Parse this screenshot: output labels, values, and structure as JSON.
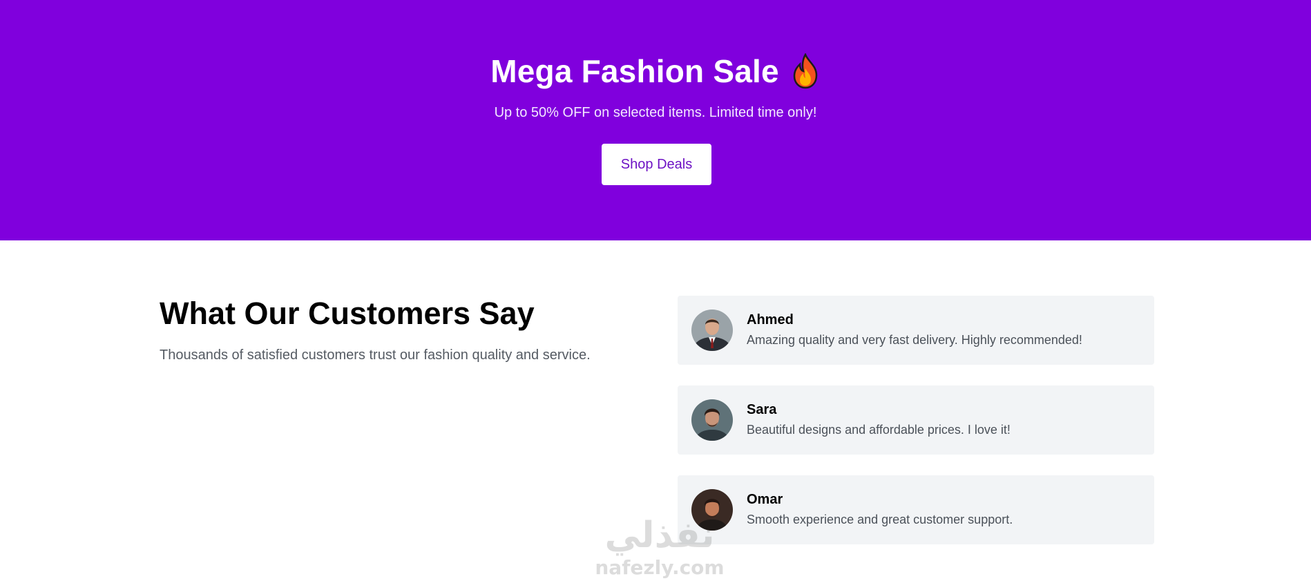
{
  "hero": {
    "title": "Mega Fashion Sale",
    "title_icon": "fire-icon",
    "subtitle": "Up to 50% OFF on selected items. Limited time only!",
    "button_label": "Shop Deals",
    "background_color": "#8000dd",
    "button_text_color": "#6d12c4"
  },
  "testimonials": {
    "heading": "What Our Customers Say",
    "subheading": "Thousands of satisfied customers trust our fashion quality and service.",
    "reviews": [
      {
        "name": "Ahmed",
        "text": "Amazing quality and very fast delivery. Highly recommended!",
        "avatar": "avatar-photo"
      },
      {
        "name": "Sara",
        "text": "Beautiful designs and affordable prices. I love it!",
        "avatar": "avatar-photo"
      },
      {
        "name": "Omar",
        "text": "Smooth experience and great customer support.",
        "avatar": "avatar-photo"
      }
    ]
  },
  "watermark": {
    "arabic": "نفذلي",
    "latin": "nafezly.com"
  }
}
